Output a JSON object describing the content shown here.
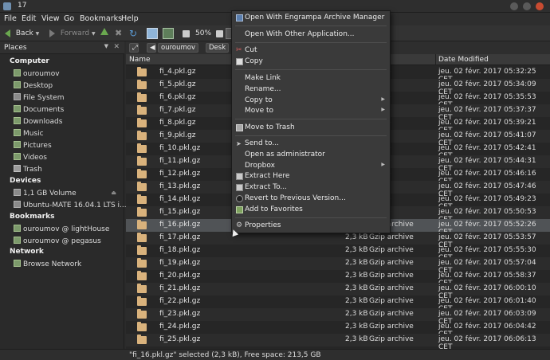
{
  "window": {
    "title": "17"
  },
  "menubar": [
    "File",
    "Edit",
    "View",
    "Go",
    "Bookmarks",
    "Help"
  ],
  "toolbar": {
    "back": "Back",
    "forward": "Forward",
    "zoom": "50%"
  },
  "location": {
    "crumb1": "ouroumov",
    "crumb2": "Desk"
  },
  "sidepane": {
    "title": "Places",
    "sections": {
      "computer": "Computer",
      "devices": "Devices",
      "bookmarks": "Bookmarks",
      "network": "Network"
    },
    "computer_items": [
      "ouroumov",
      "Desktop",
      "File System",
      "Documents",
      "Downloads",
      "Music",
      "Pictures",
      "Videos",
      "Trash"
    ],
    "device_items": [
      "1,1 GB Volume",
      "Ubuntu-MATE 16.04.1 LTS i..."
    ],
    "bookmark_items": [
      "ouroumov @ lightHouse",
      "ouroumov @ pegasus"
    ],
    "network_items": [
      "Browse Network"
    ]
  },
  "columns": {
    "name": "Name",
    "date": "Date Modified"
  },
  "files": [
    {
      "name": "fi_4.pkl.gz",
      "size": "",
      "type": "rchive",
      "date": "jeu. 02 févr. 2017 05:32:25 CET"
    },
    {
      "name": "fi_5.pkl.gz",
      "size": "",
      "type": "rchive",
      "date": "jeu. 02 févr. 2017 05:34:09 CET"
    },
    {
      "name": "fi_6.pkl.gz",
      "size": "",
      "type": "rchive",
      "date": "jeu. 02 févr. 2017 05:35:53 CET"
    },
    {
      "name": "fi_7.pkl.gz",
      "size": "",
      "type": "rchive",
      "date": "jeu. 02 févr. 2017 05:37:37 CET"
    },
    {
      "name": "fi_8.pkl.gz",
      "size": "",
      "type": "rchive",
      "date": "jeu. 02 févr. 2017 05:39:21 CET"
    },
    {
      "name": "fi_9.pkl.gz",
      "size": "",
      "type": "rchive",
      "date": "jeu. 02 févr. 2017 05:41:07 CET"
    },
    {
      "name": "fi_10.pkl.gz",
      "size": "",
      "type": "rchive",
      "date": "jeu. 02 févr. 2017 05:42:41 CET"
    },
    {
      "name": "fi_11.pkl.gz",
      "size": "",
      "type": "rchive",
      "date": "jeu. 02 févr. 2017 05:44:31 CET"
    },
    {
      "name": "fi_12.pkl.gz",
      "size": "",
      "type": "rchive",
      "date": "jeu. 02 févr. 2017 05:46:16 CET"
    },
    {
      "name": "fi_13.pkl.gz",
      "size": "",
      "type": "rchive",
      "date": "jeu. 02 févr. 2017 05:47:46 CET"
    },
    {
      "name": "fi_14.pkl.gz",
      "size": "",
      "type": "rchive",
      "date": "jeu. 02 févr. 2017 05:49:23 CET"
    },
    {
      "name": "fi_15.pkl.gz",
      "size": "",
      "type": "rchive",
      "date": "jeu. 02 févr. 2017 05:50:53 CET"
    },
    {
      "name": "fi_16.pkl.gz",
      "size": "2,3 kB",
      "type": "Gzip archive",
      "date": "jeu. 02 févr. 2017 05:52:26 CET",
      "selected": true
    },
    {
      "name": "fi_17.pkl.gz",
      "size": "2,3 kB",
      "type": "Gzip archive",
      "date": "jeu. 02 févr. 2017 05:53:57 CET"
    },
    {
      "name": "fi_18.pkl.gz",
      "size": "2,3 kB",
      "type": "Gzip archive",
      "date": "jeu. 02 févr. 2017 05:55:30 CET"
    },
    {
      "name": "fi_19.pkl.gz",
      "size": "2,3 kB",
      "type": "Gzip archive",
      "date": "jeu. 02 févr. 2017 05:57:04 CET"
    },
    {
      "name": "fi_20.pkl.gz",
      "size": "2,3 kB",
      "type": "Gzip archive",
      "date": "jeu. 02 févr. 2017 05:58:37 CET"
    },
    {
      "name": "fi_21.pkl.gz",
      "size": "2,3 kB",
      "type": "Gzip archive",
      "date": "jeu. 02 févr. 2017 06:00:10 CET"
    },
    {
      "name": "fi_22.pkl.gz",
      "size": "2,3 kB",
      "type": "Gzip archive",
      "date": "jeu. 02 févr. 2017 06:01:40 CET"
    },
    {
      "name": "fi_23.pkl.gz",
      "size": "2,3 kB",
      "type": "Gzip archive",
      "date": "jeu. 02 févr. 2017 06:03:09 CET"
    },
    {
      "name": "fi_24.pkl.gz",
      "size": "2,3 kB",
      "type": "Gzip archive",
      "date": "jeu. 02 févr. 2017 06:04:42 CET"
    },
    {
      "name": "fi_25.pkl.gz",
      "size": "2,3 kB",
      "type": "Gzip archive",
      "date": "jeu. 02 févr. 2017 06:06:13 CET"
    }
  ],
  "status": "\"fi_16.pkl.gz\" selected (2,3 kB), Free space: 213,5 GB",
  "context_menu": [
    {
      "label": "Open With Engrampa Archive Manager",
      "icon": "archive-icon"
    },
    {
      "label": "Open With Other Application..."
    },
    {
      "label": "Cut",
      "icon": "cut-icon"
    },
    {
      "label": "Copy",
      "icon": "copy-icon"
    },
    {
      "label": "Make Link"
    },
    {
      "label": "Rename..."
    },
    {
      "label": "Copy to",
      "submenu": true
    },
    {
      "label": "Move to",
      "submenu": true
    },
    {
      "label": "Move to Trash",
      "icon": "trash-icon"
    },
    {
      "label": "Send to...",
      "icon": "send-icon"
    },
    {
      "label": "Open as administrator"
    },
    {
      "label": "Dropbox",
      "submenu": true
    },
    {
      "label": "Extract Here",
      "icon": "extract-icon"
    },
    {
      "label": "Extract To...",
      "icon": "extract-to-icon"
    },
    {
      "label": "Revert to Previous Version...",
      "icon": "revert-icon"
    },
    {
      "label": "Add to Favorites",
      "icon": "favorites-icon"
    },
    {
      "label": "Properties",
      "icon": "gear-icon"
    }
  ]
}
